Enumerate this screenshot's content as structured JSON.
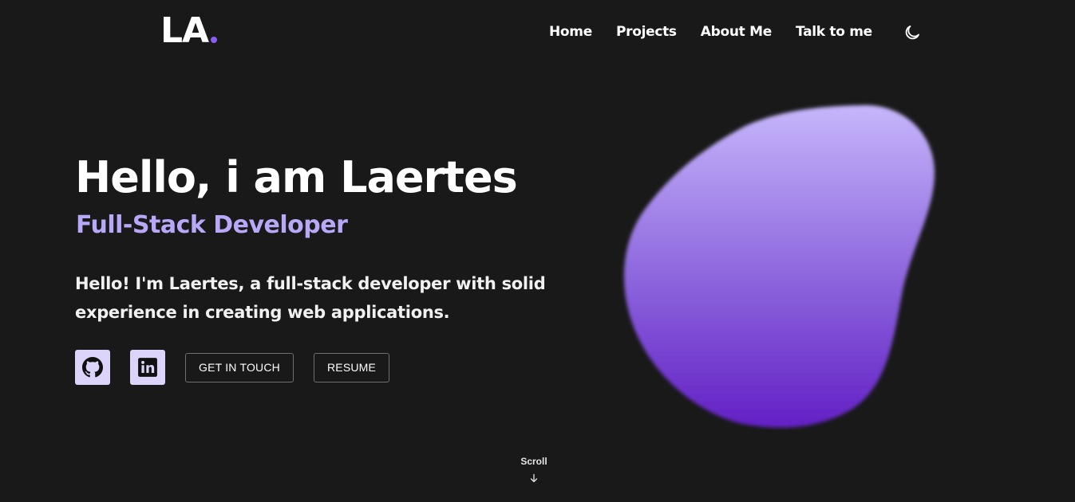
{
  "header": {
    "logo_text": "LA",
    "nav": [
      {
        "label": "Home"
      },
      {
        "label": "Projects"
      },
      {
        "label": "About Me"
      },
      {
        "label": "Talk to me"
      }
    ],
    "theme_toggle_icon": "moon-icon"
  },
  "hero": {
    "title": "Hello, i am Laertes",
    "subtitle": "Full-Stack Developer",
    "description": "Hello! I'm Laertes, a full-stack developer with solid experience in creating web applications.",
    "social": [
      {
        "icon": "github-icon"
      },
      {
        "icon": "linkedin-icon"
      }
    ],
    "buttons": {
      "contact": "GET IN TOUCH",
      "resume": "RESUME"
    }
  },
  "scroll": {
    "label": "Scroll",
    "icon": "arrow-down-icon"
  },
  "colors": {
    "background": "#191919",
    "accent": "#8b5cf6",
    "subtitle": "#b9a7f8",
    "social_bg": "#ddd4fb",
    "blob_top": "#c6b6fb",
    "blob_bottom": "#6320c5"
  }
}
